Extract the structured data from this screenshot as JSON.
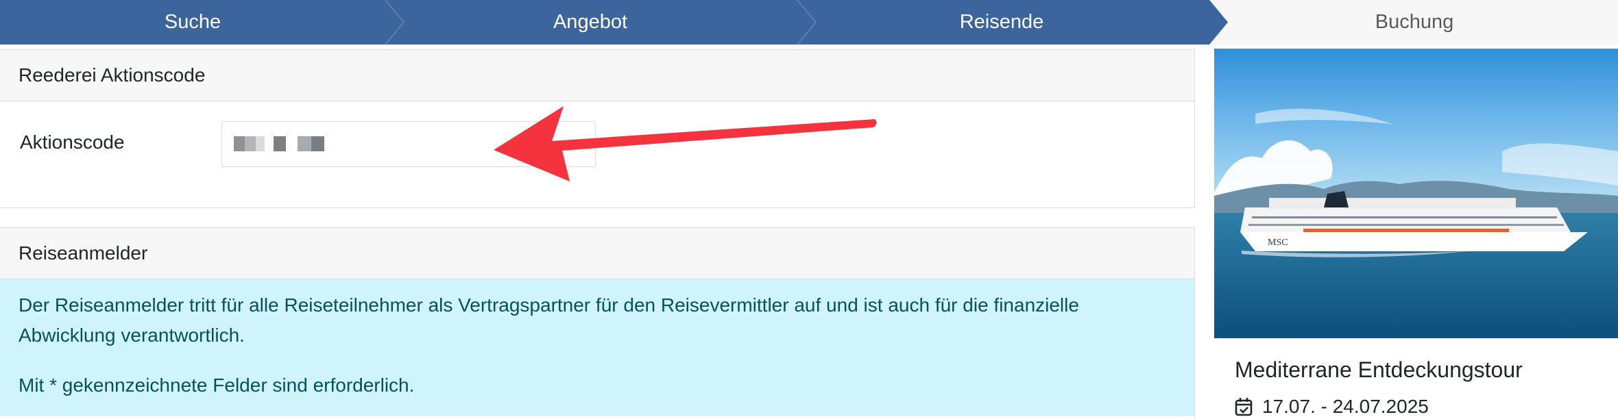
{
  "steps": [
    {
      "label": "Suche",
      "state": "done"
    },
    {
      "label": "Angebot",
      "state": "done"
    },
    {
      "label": "Reisende",
      "state": "done"
    },
    {
      "label": "Buchung",
      "state": "current"
    }
  ],
  "colors": {
    "step_done": "#3c659d",
    "step_done_edge": "#5a7fb1",
    "step_todo": "#f7f7f7",
    "card_border": "#dcdcdc",
    "card_header_bg": "#f7f7f7",
    "info_bg": "#cff4fc",
    "info_text": "#055160",
    "annotation_arrow": "#f5333f"
  },
  "promo_card": {
    "title": "Reederei Aktionscode",
    "field_label": "Aktionscode",
    "field_value_state": "blurred"
  },
  "traveler_card": {
    "title": "Reiseanmelder",
    "info_text": "Der Reiseanmelder tritt für alle Reiseteilnehmer als Vertragspartner für den Reisevermittler auf und ist auch für die finanzielle Abwicklung verantwortlich.",
    "required_note": "Mit * gekennzeichnete Felder sind erforderlich."
  },
  "trip": {
    "image_alt": "Kreuzfahrtschiff",
    "ship_brand_mark": "MSC",
    "title": "Mediterrane Entdeckungstour",
    "dates": "17.07. - 24.07.2025",
    "date_icon": "calendar-check-icon"
  },
  "annotation": {
    "type": "arrow",
    "points_to": "Aktionscode input"
  }
}
